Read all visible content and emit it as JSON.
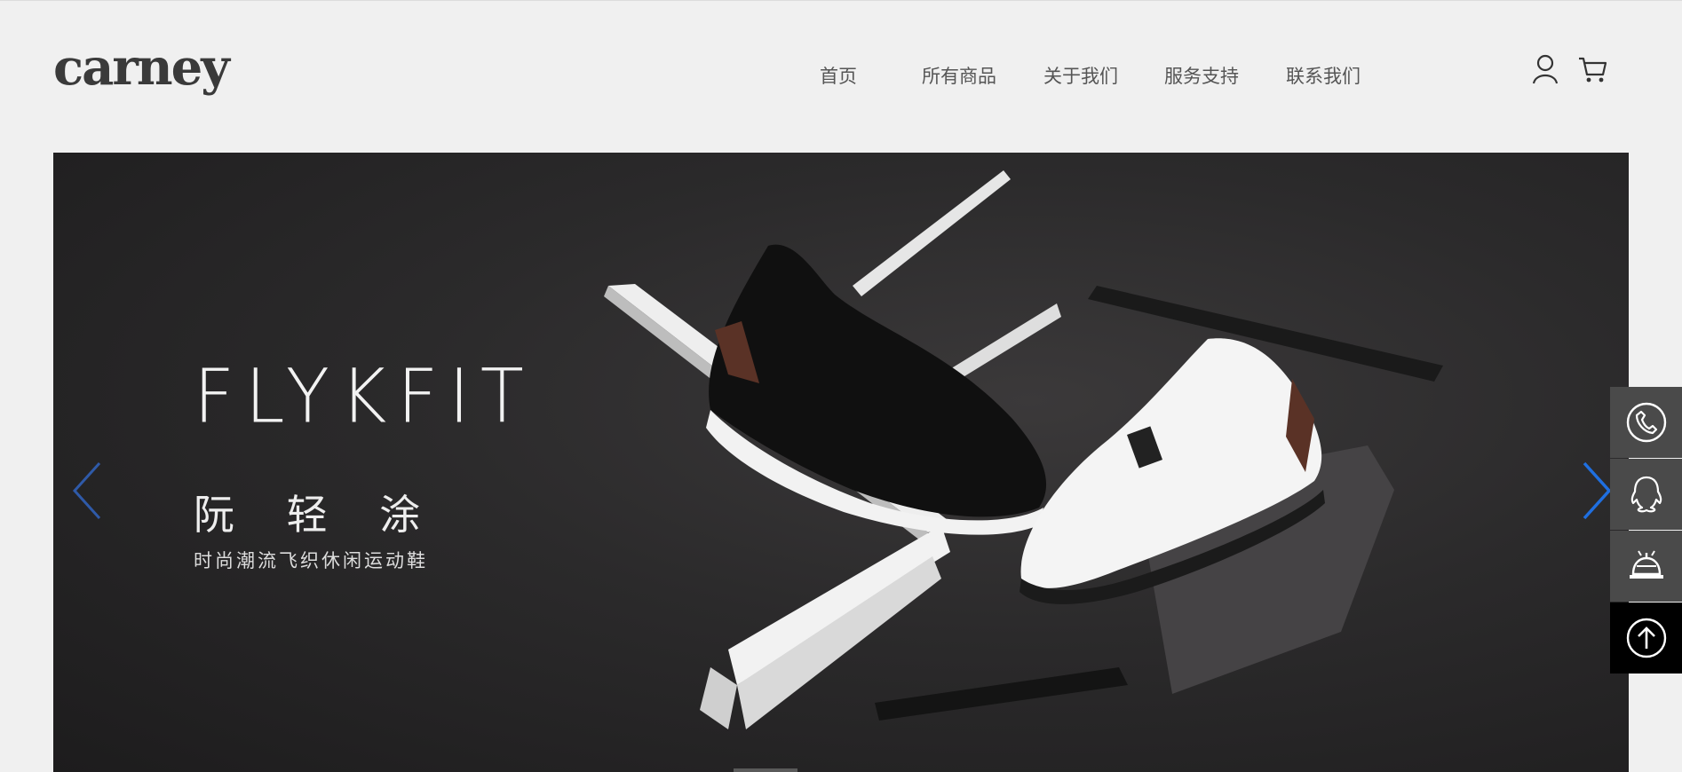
{
  "header": {
    "logo": "carney",
    "nav": [
      {
        "label": "首页"
      },
      {
        "label": "所有商品"
      },
      {
        "label": "关于我们"
      },
      {
        "label": "服务支持"
      },
      {
        "label": "联系我们"
      }
    ],
    "icons": [
      "user-icon",
      "cart-icon"
    ]
  },
  "banner": {
    "title": "FLYKFIT",
    "name": "阮 轻 涂",
    "tagline": "时尚潮流飞织休闲运动鞋",
    "prev_icon": "chevron-left-icon",
    "next_icon": "chevron-right-icon",
    "prev_color": "#2f5aa8",
    "next_color": "#1f6fe0"
  },
  "sidebar": {
    "icons": [
      "phone-icon",
      "qq-icon",
      "service-bell-icon",
      "back-to-top-icon"
    ]
  }
}
